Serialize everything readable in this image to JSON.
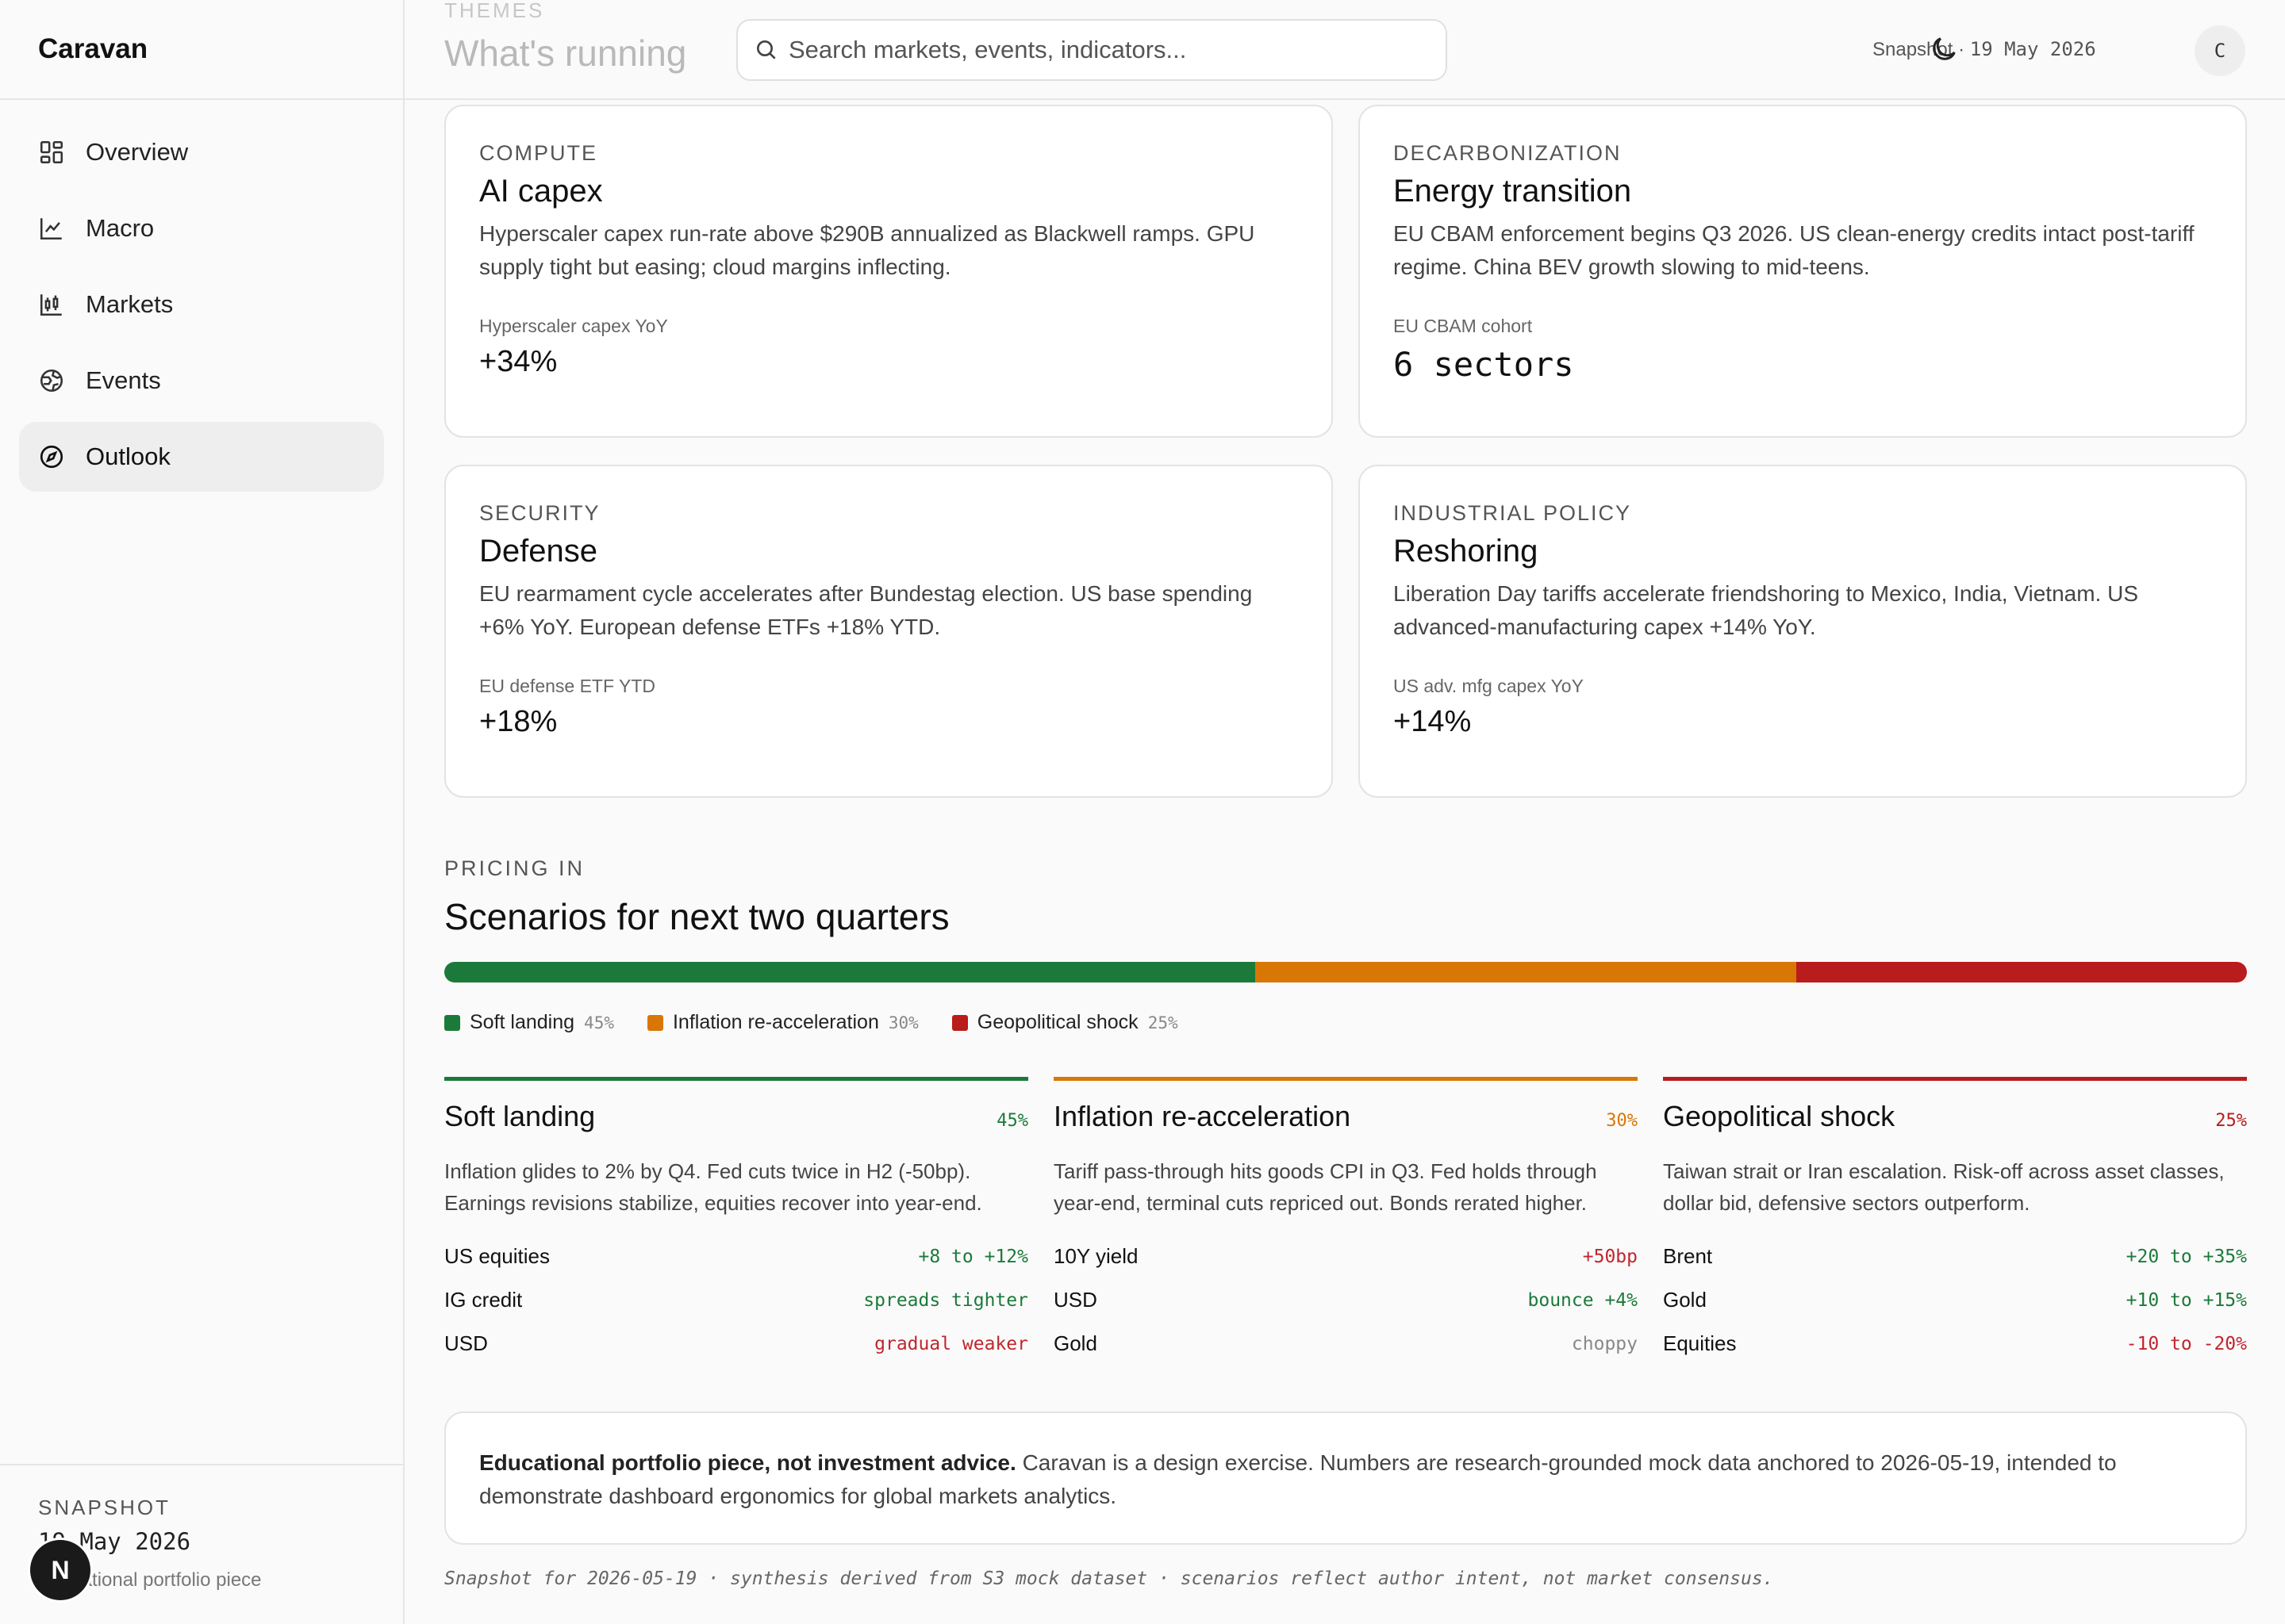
{
  "app": {
    "name": "Caravan"
  },
  "sidebar": {
    "items": [
      {
        "label": "Overview",
        "icon": "grid-icon"
      },
      {
        "label": "Macro",
        "icon": "line-chart-icon"
      },
      {
        "label": "Markets",
        "icon": "candlestick-icon"
      },
      {
        "label": "Events",
        "icon": "globe-icon"
      },
      {
        "label": "Outlook",
        "icon": "compass-icon",
        "active": true
      }
    ],
    "footer": {
      "label": "SNAPSHOT",
      "date": "19 May 2026",
      "subtitle": "Educational portfolio piece",
      "badge": "N"
    }
  },
  "header": {
    "eyebrow": "THEMES",
    "title": "What's running",
    "search_placeholder": "Search markets, events, indicators...",
    "snapshot_label": "Snapshot",
    "snapshot_date": "19 May 2026",
    "avatar_initial": "C"
  },
  "themes": [
    {
      "eyebrow": "COMPUTE",
      "title": "AI capex",
      "description": "Hyperscaler capex run-rate above $290B annualized as Blackwell ramps. GPU supply tight but easing; cloud margins inflecting.",
      "metric_label": "Hyperscaler capex YoY",
      "metric_value": "+34%"
    },
    {
      "eyebrow": "DECARBONIZATION",
      "title": "Energy transition",
      "description": "EU CBAM enforcement begins Q3 2026. US clean-energy credits intact post-tariff regime. China BEV growth slowing to mid-teens.",
      "metric_label": "EU CBAM cohort",
      "metric_value": "6 sectors"
    },
    {
      "eyebrow": "SECURITY",
      "title": "Defense",
      "description": "EU rearmament cycle accelerates after Bundestag election. US base spending +6% YoY. European defense ETFs +18% YTD.",
      "metric_label": "EU defense ETF YTD",
      "metric_value": "+18%"
    },
    {
      "eyebrow": "INDUSTRIAL POLICY",
      "title": "Reshoring",
      "description": "Liberation Day tariffs accelerate friendshoring to Mexico, India, Vietnam. US advanced-manufacturing capex +14% YoY.",
      "metric_label": "US adv. mfg capex YoY",
      "metric_value": "+14%"
    }
  ],
  "pricing": {
    "eyebrow": "PRICING IN",
    "title": "Scenarios for next two quarters",
    "colors": {
      "soft": "#1b7a3a",
      "inflation": "#d97706",
      "shock": "#b91c1c"
    },
    "probabilities": [
      45,
      30,
      25
    ],
    "legend": [
      {
        "label": "Soft landing",
        "pct": "45%"
      },
      {
        "label": "Inflation re-acceleration",
        "pct": "30%"
      },
      {
        "label": "Geopolitical shock",
        "pct": "25%"
      }
    ],
    "scenarios": [
      {
        "title": "Soft landing",
        "pct": "45%",
        "description": "Inflation glides to 2% by Q4. Fed cuts twice in H2 (-50bp). Earnings revisions stabilize, equities recover into year-end.",
        "rows": [
          {
            "asset": "US equities",
            "value": "+8 to +12%",
            "tone": "pos"
          },
          {
            "asset": "IG credit",
            "value": "spreads tighter",
            "tone": "pos"
          },
          {
            "asset": "USD",
            "value": "gradual weaker",
            "tone": "neg"
          }
        ]
      },
      {
        "title": "Inflation re-acceleration",
        "pct": "30%",
        "description": "Tariff pass-through hits goods CPI in Q3. Fed holds through year-end, terminal cuts repriced out. Bonds rerated higher.",
        "rows": [
          {
            "asset": "10Y yield",
            "value": "+50bp",
            "tone": "neg"
          },
          {
            "asset": "USD",
            "value": "bounce +4%",
            "tone": "pos"
          },
          {
            "asset": "Gold",
            "value": "choppy",
            "tone": "neu"
          }
        ]
      },
      {
        "title": "Geopolitical shock",
        "pct": "25%",
        "description": "Taiwan strait or Iran escalation. Risk-off across asset classes, dollar bid, defensive sectors outperform.",
        "rows": [
          {
            "asset": "Brent",
            "value": "+20 to +35%",
            "tone": "pos"
          },
          {
            "asset": "Gold",
            "value": "+10 to +15%",
            "tone": "pos"
          },
          {
            "asset": "Equities",
            "value": "-10 to -20%",
            "tone": "neg"
          }
        ]
      }
    ]
  },
  "disclaimer": {
    "bold": "Educational portfolio piece, not investment advice.",
    "text": "Caravan is a design exercise. Numbers are research-grounded mock data anchored to 2026-05-19, intended to demonstrate dashboard ergonomics for global markets analytics."
  },
  "footnote": "Snapshot for 2026-05-19 · synthesis derived from S3 mock dataset · scenarios reflect author intent, not market consensus."
}
